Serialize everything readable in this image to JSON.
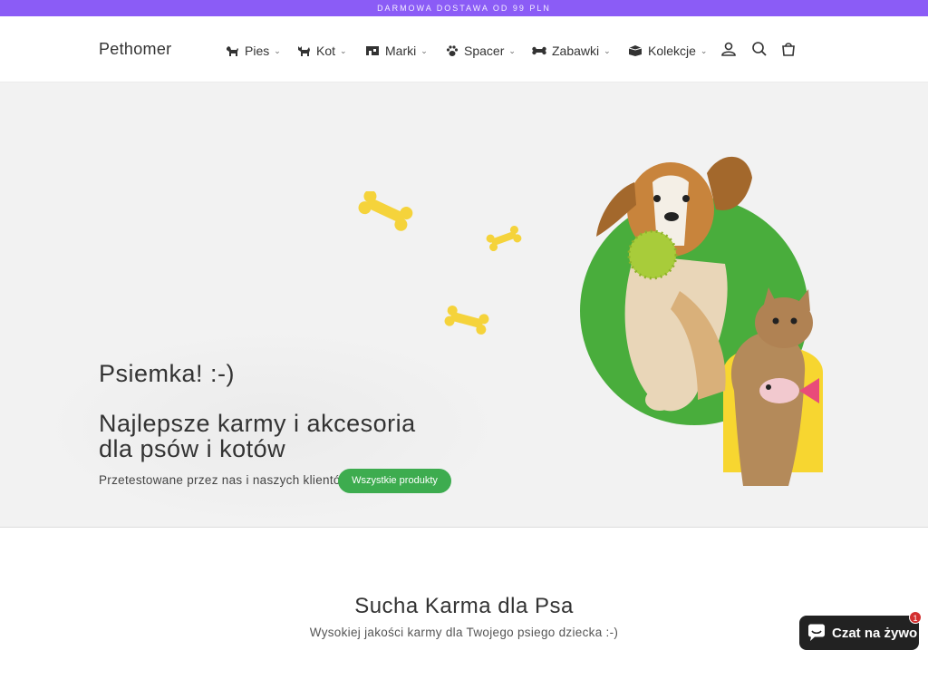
{
  "announcement": "Darmowa dostawa od 99 PLN",
  "header": {
    "logo": "Pethomer",
    "nav": [
      {
        "label": "Pies",
        "icon": "dog-icon"
      },
      {
        "label": "Kot",
        "icon": "cat-icon"
      },
      {
        "label": "Marki",
        "icon": "shop-icon"
      },
      {
        "label": "Spacer",
        "icon": "paw-icon"
      },
      {
        "label": "Zabawki",
        "icon": "bone-icon"
      },
      {
        "label": "Kolekcje",
        "icon": "box-icon"
      }
    ],
    "icons": [
      "user-icon",
      "search-icon",
      "cart-icon"
    ]
  },
  "hero": {
    "kicker": "Psiemka! :-)",
    "title": "Najlepsze karmy i akcesoria dla psów i kotów",
    "subtitle": "Przetestowane przez nas i naszych klientów",
    "button": "Wszystkie produkty"
  },
  "section": {
    "title": "Sucha Karma dla Psa",
    "subtitle": "Wysokiej jakości karmy dla Twojego psiego dziecka :-)"
  },
  "chat": {
    "label": "Czat na żywo",
    "badge": "1"
  },
  "colors": {
    "announcement_bg": "#8b5cf6",
    "accent_green": "#3dac4f",
    "bone_yellow": "#f5d33b",
    "chat_bg": "#222222",
    "badge_red": "#d32f2f"
  }
}
